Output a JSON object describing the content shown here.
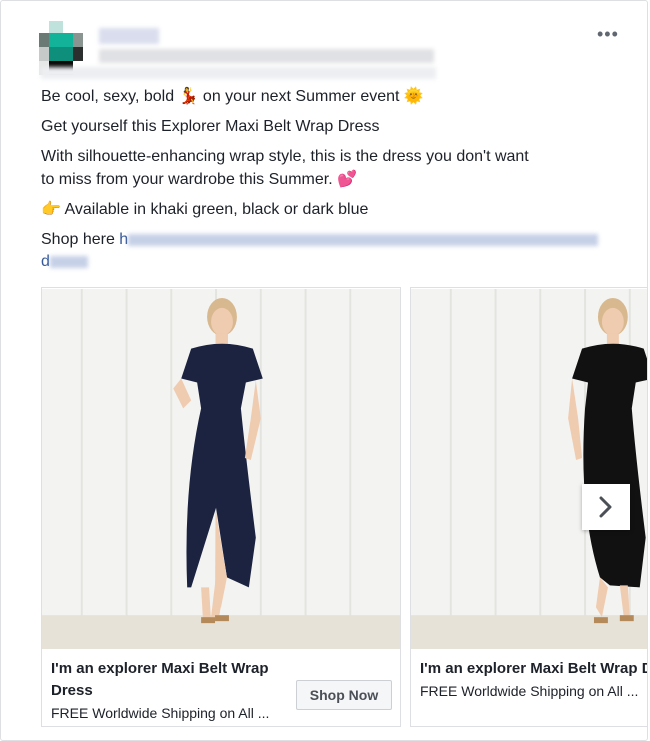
{
  "post": {
    "more_label": "•••",
    "lines": [
      "Be cool, sexy, bold 💃 on your next Summer event 🌞",
      "Get yourself this Explorer Maxi Belt Wrap Dress",
      "With silhouette-enhancing wrap style, this is the dress you don't want",
      "to miss from your wardrobe this Summer. 💕",
      "👉 Available in khaki green, black or dark blue"
    ],
    "shop_prefix": "Shop here",
    "shop_link_start": "h",
    "shop_link_line2": "d"
  },
  "carousel": {
    "items": [
      {
        "title": "I'm an explorer Maxi Belt Wrap Dress",
        "subtitle": "FREE Worldwide Shipping on All ...",
        "cta": "Shop Now",
        "dress_color": "#1b2340"
      },
      {
        "title": "I'm an explorer Maxi Belt Wrap Dress",
        "subtitle": "FREE Worldwide Shipping on All ...",
        "dress_color": "#111111"
      }
    ]
  },
  "colors": {
    "text": "#1d2129",
    "border": "#dddfe2",
    "button_bg": "#f5f6f7"
  }
}
